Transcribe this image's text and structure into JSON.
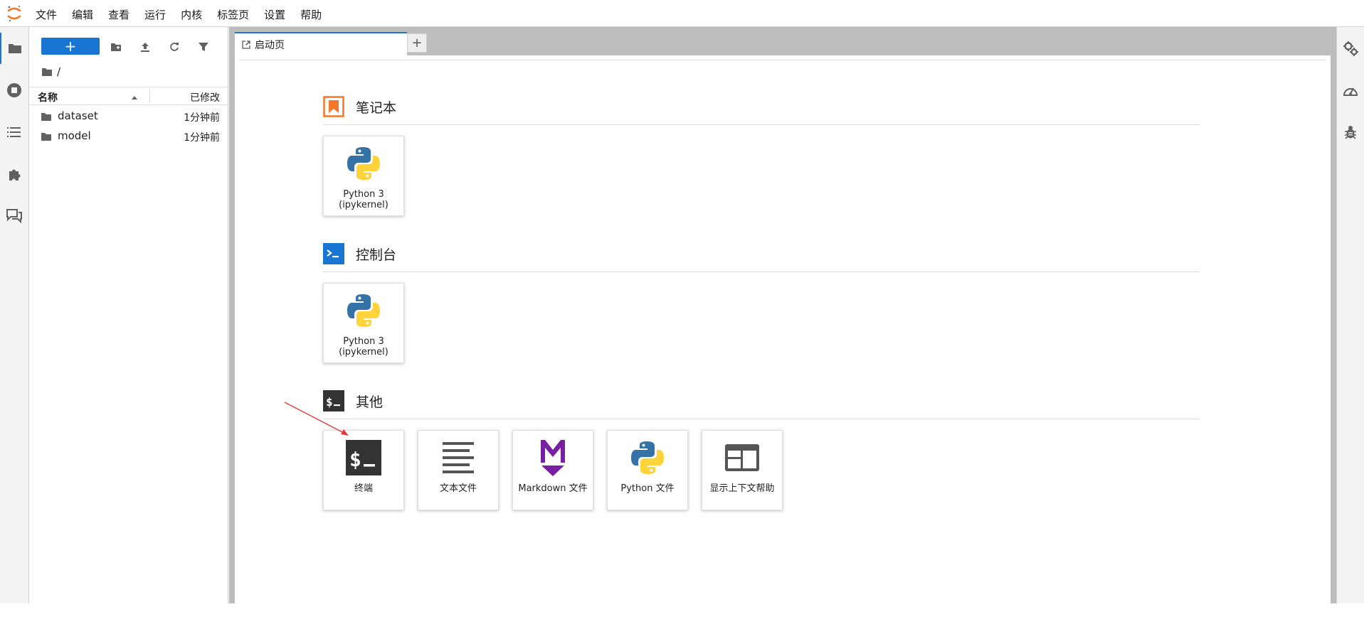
{
  "menubar": {
    "items": [
      "文件",
      "编辑",
      "查看",
      "运行",
      "内核",
      "标签页",
      "设置",
      "帮助"
    ]
  },
  "left_strip": {
    "icons": [
      "folder-icon",
      "running-icon",
      "toc-icon",
      "extension-icon",
      "chat-icon"
    ]
  },
  "filebrowser": {
    "new_button_label": "+",
    "breadcrumb": "/",
    "col_name": "名称",
    "col_modified": "已修改",
    "rows": [
      {
        "name": "dataset",
        "modified": "1分钟前"
      },
      {
        "name": "model",
        "modified": "1分钟前"
      }
    ]
  },
  "tabs": {
    "launcher_label": "启动页",
    "add_label": "+"
  },
  "launcher": {
    "notebook": {
      "title": "笔记本",
      "cards": [
        {
          "label": "Python 3\n(ipykernel)"
        }
      ]
    },
    "console": {
      "title": "控制台",
      "cards": [
        {
          "label": "Python 3\n(ipykernel)"
        }
      ]
    },
    "other": {
      "title": "其他",
      "cards": [
        {
          "label": "终端"
        },
        {
          "label": "文本文件"
        },
        {
          "label": "Markdown 文件"
        },
        {
          "label": "Python 文件"
        },
        {
          "label": "显示上下文帮助"
        }
      ]
    }
  },
  "colors": {
    "accent": "#1976d2",
    "notebook_orange": "#f37726",
    "markdown_purple": "#7b1fa2",
    "python_blue": "#3572a5",
    "python_yellow": "#ffd43b",
    "annotation_red": "#e53935"
  }
}
